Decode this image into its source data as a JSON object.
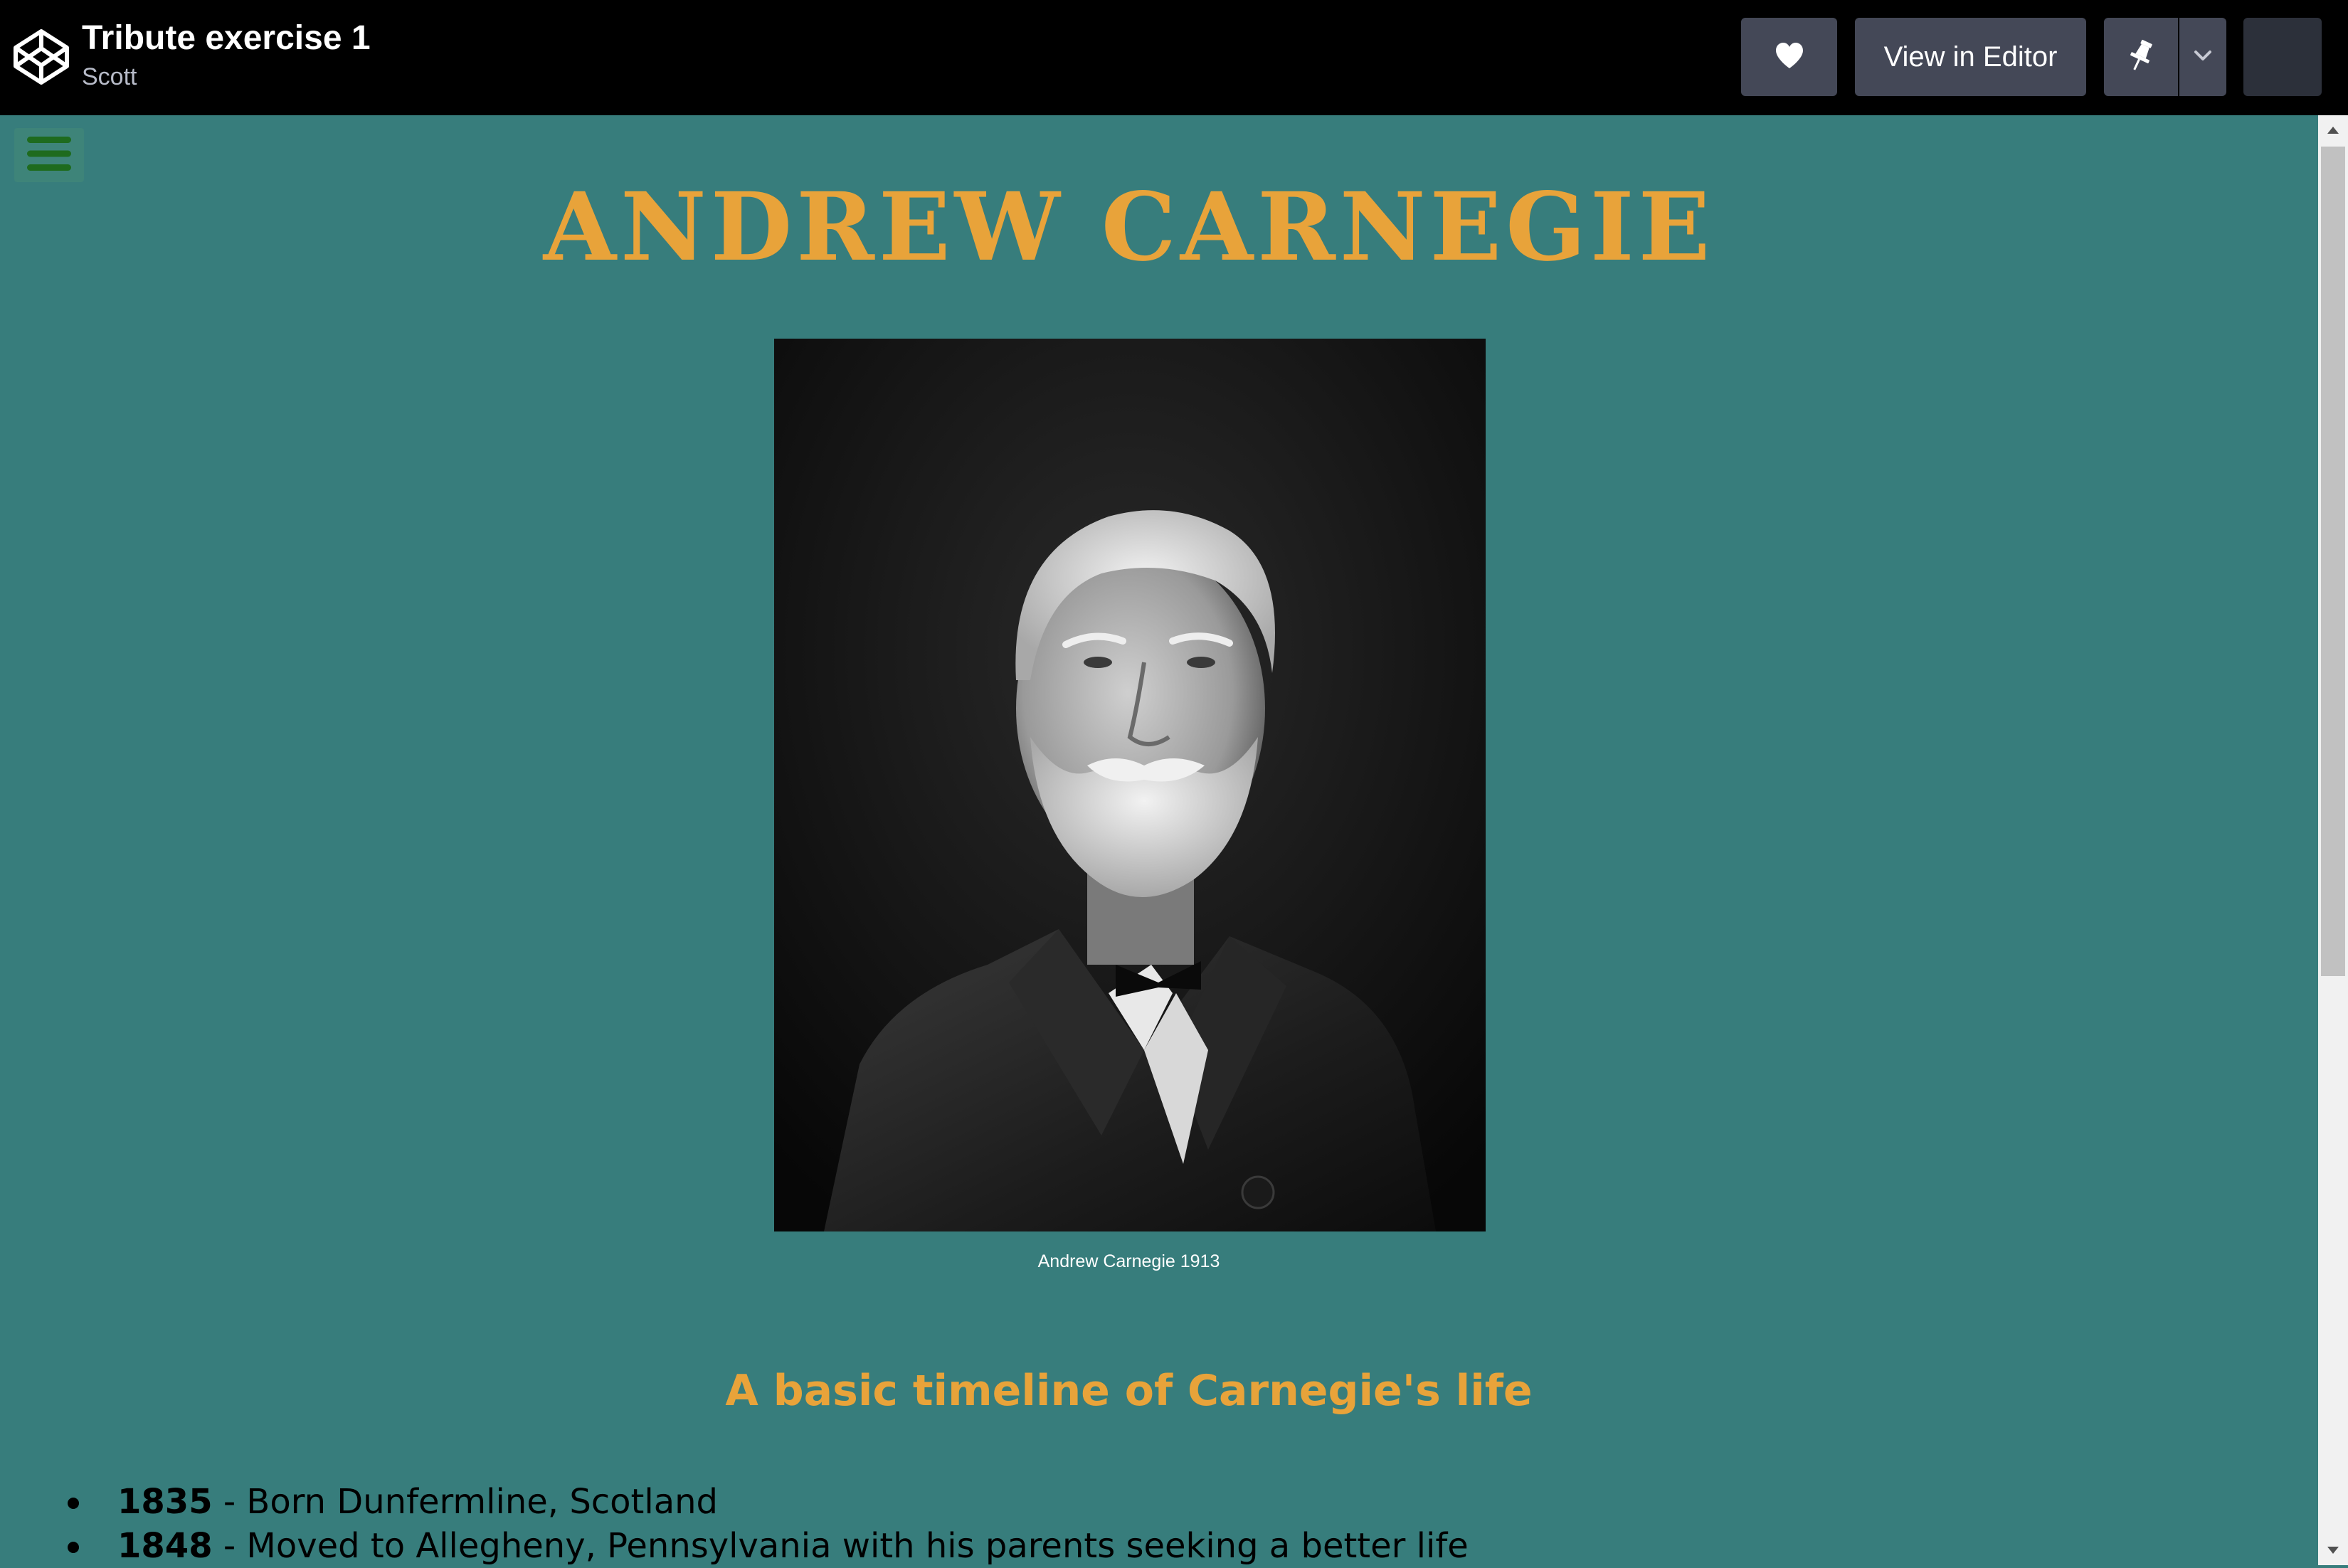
{
  "header": {
    "pen_title": "Tribute exercise 1",
    "author": "Scott",
    "logo_icon": "codepen-logo-icon",
    "like_icon": "heart-icon",
    "view_in_editor_label": "View in Editor",
    "pin_icon": "pin-icon",
    "more_icon": "chevron-down-icon"
  },
  "page": {
    "menu_icon": "hamburger-menu-icon",
    "title": "ANDREW CARNEGIE",
    "image_caption": "Andrew Carnegie 1913",
    "timeline_heading": "A basic timeline of Carnegie's life",
    "timeline": [
      {
        "year": "1835",
        "text": " - Born Dunfermline, Scotland"
      },
      {
        "year": "1848",
        "text": " - Moved to Allegheny, Pennsylvania with his parents seeking a better life"
      }
    ]
  },
  "colors": {
    "topbar_bg": "#000000",
    "page_bg": "#377d7c",
    "accent": "#e8a33a",
    "button_bg": "#444857",
    "menu_icon": "#1e6b1e"
  }
}
